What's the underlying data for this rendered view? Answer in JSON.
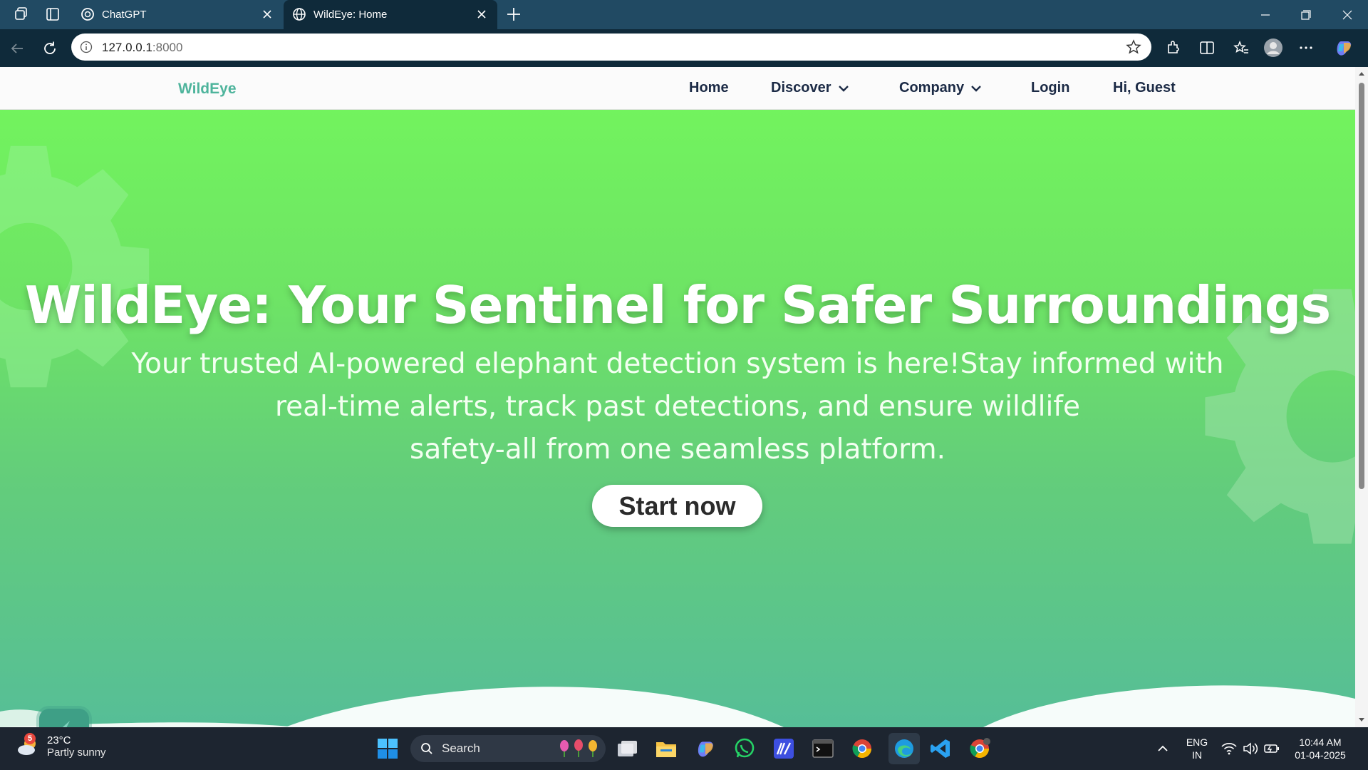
{
  "browser": {
    "tabs": [
      {
        "label": "ChatGPT",
        "active": false
      },
      {
        "label": "WildEye: Home",
        "active": true
      }
    ],
    "url": {
      "host": "127.0.0.1",
      "port": ":8000"
    }
  },
  "site": {
    "brand": "WildEye",
    "nav": {
      "home": "Home",
      "discover": "Discover",
      "company": "Company",
      "login": "Login",
      "greeting": "Hi, Guest"
    },
    "hero": {
      "title": "WildEye: Your Sentinel for Safer Surroundings",
      "subtitle_line1": "Your trusted AI-powered elephant detection system is here!Stay informed with",
      "subtitle_line2": "real-time alerts, track past detections, and ensure wildlife",
      "subtitle_line3": "safety-all from one seamless platform.",
      "cta": "Start now"
    }
  },
  "taskbar": {
    "weather": {
      "temp": "23°C",
      "condition": "Partly sunny",
      "badge": "5"
    },
    "search_placeholder": "Search",
    "lang": {
      "line1": "ENG",
      "line2": "IN"
    },
    "clock": {
      "time": "10:44 AM",
      "date": "01-04-2025"
    }
  },
  "colors": {
    "brand": "#4eb49c",
    "hero_top": "#72f35e",
    "hero_bottom": "#56be97",
    "nav_text": "#1b2a45"
  }
}
